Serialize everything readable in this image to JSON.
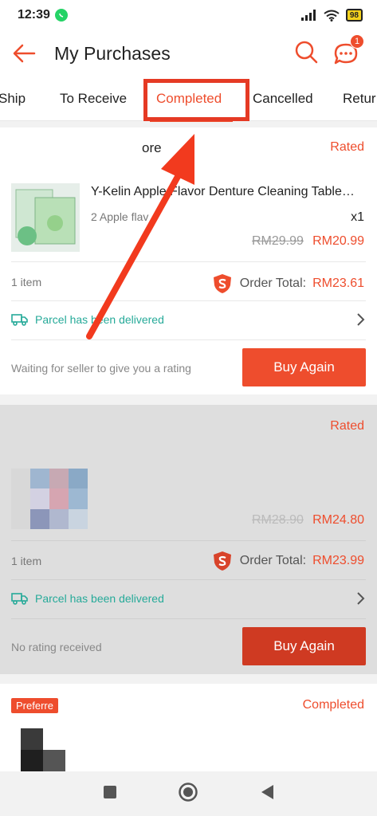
{
  "status_bar": {
    "time": "12:39",
    "battery": "98"
  },
  "header": {
    "title": "My Purchases",
    "back_icon": "arrow-left-icon",
    "search_icon": "search-icon",
    "chat_icon": "chat-icon",
    "chat_badge": "1"
  },
  "tabs": [
    {
      "label": "Ship"
    },
    {
      "label": "To Receive"
    },
    {
      "label": "Completed",
      "active": true
    },
    {
      "label": "Cancelled"
    },
    {
      "label": "Retur"
    }
  ],
  "orders": [
    {
      "shop": "ore",
      "status": "Rated",
      "product_name": "Y-Kelin Apple Flavor Denture Cleaning Table…",
      "variation": "2 Apple flav",
      "qty": "x1",
      "old_price": "RM29.99",
      "new_price": "RM20.99",
      "items": "1 item",
      "total_label": "Order Total:",
      "total": "RM23.61",
      "delivery": "Parcel has been delivered",
      "note": "Waiting for seller to give you a rating",
      "button": "Buy Again"
    },
    {
      "status": "Rated",
      "old_price": "RM28.90",
      "new_price": "RM24.80",
      "items": "1 item",
      "total_label": "Order Total:",
      "total": "RM23.99",
      "delivery": "Parcel has been delivered",
      "note": "No rating received",
      "button": "Buy Again"
    },
    {
      "badge": "Preferre",
      "status": "Completed"
    }
  ],
  "colors": {
    "accent": "#ee4d2d",
    "teal": "#26aa99",
    "annotation_red": "#e53a24"
  }
}
